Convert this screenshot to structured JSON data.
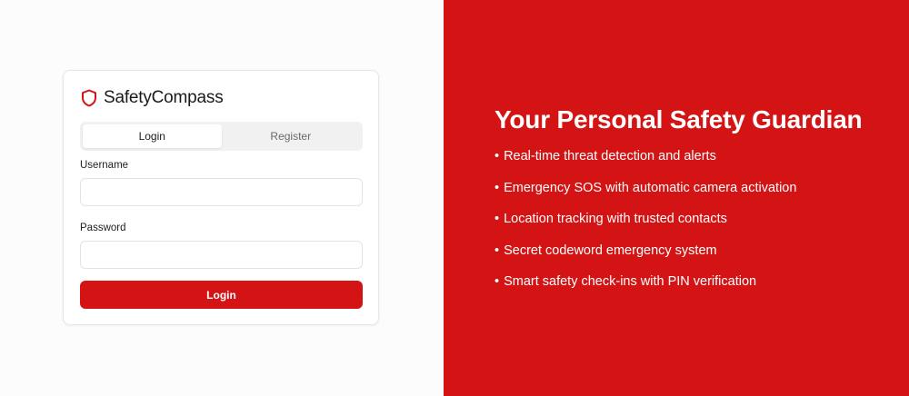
{
  "brand": {
    "name": "SafetyCompass",
    "icon": "shield-icon",
    "accent_color": "#d41414"
  },
  "auth": {
    "tabs": [
      {
        "label": "Login",
        "active": true
      },
      {
        "label": "Register",
        "active": false
      }
    ],
    "username_label": "Username",
    "username_value": "",
    "password_label": "Password",
    "password_value": "",
    "submit_label": "Login"
  },
  "hero": {
    "title": "Your Personal Safety Guardian",
    "bullet": "•",
    "features": [
      "Real-time threat detection and alerts",
      "Emergency SOS with automatic camera activation",
      "Location tracking with trusted contacts",
      "Secret codeword emergency system",
      "Smart safety check-ins with PIN verification"
    ]
  }
}
